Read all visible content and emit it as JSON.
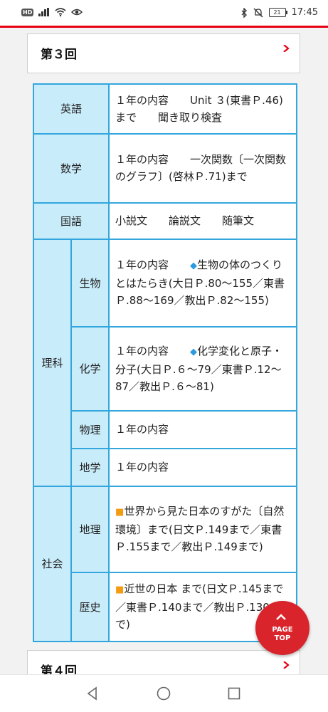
{
  "status": {
    "hd": "HD",
    "battery": "21",
    "time": "17:45"
  },
  "sections": {
    "third_title": "第３回",
    "fourth_title": "第４回"
  },
  "rows": {
    "english": {
      "subject": "英語",
      "content": "１年の内容　　Unit ３(東書Ｐ.46)まで　　聞き取り検査"
    },
    "math": {
      "subject": "数学",
      "content": "１年の内容　　一次関数〔一次関数のグラフ〕(啓林Ｐ.71)まで"
    },
    "japanese": {
      "subject": "国語",
      "content": "小説文　　論説文　　随筆文"
    },
    "science": {
      "subject": "理科",
      "biology": {
        "sub": "生物",
        "lead": "１年の内容　　",
        "bullet": "◆",
        "content": "生物の体のつくりとはたらき(大日Ｐ.80〜155／東書Ｐ.88〜169／教出Ｐ.82〜155)"
      },
      "chemistry": {
        "sub": "化学",
        "lead": "１年の内容　　",
        "bullet": "◆",
        "content": "化学変化と原子・分子(大日Ｐ.６〜79／東書Ｐ.12〜87／教出Ｐ.６〜81)"
      },
      "physics": {
        "sub": "物理",
        "content": "１年の内容"
      },
      "earth": {
        "sub": "地学",
        "content": "１年の内容"
      }
    },
    "social": {
      "subject": "社会",
      "geography": {
        "sub": "地理",
        "bullet": "■",
        "content": "世界から見た日本のすがた〔自然環境〕まで(日文Ｐ.149まで／東書Ｐ.155まで／教出Ｐ.149まで)"
      },
      "history": {
        "sub": "歴史",
        "bullet": "■",
        "content": "近世の日本 まで(日文Ｐ.145まで／東書Ｐ.140まで／教出Ｐ.130まで)"
      }
    }
  },
  "page_top": {
    "line1": "PAGE",
    "line2": "TOP"
  },
  "colors": {
    "accent_red": "#e60012",
    "table_border": "#33a7dd",
    "header_bg": "#c9ecfa",
    "bullet_blue": "#2b9be0",
    "bullet_orange": "#f39c12"
  }
}
